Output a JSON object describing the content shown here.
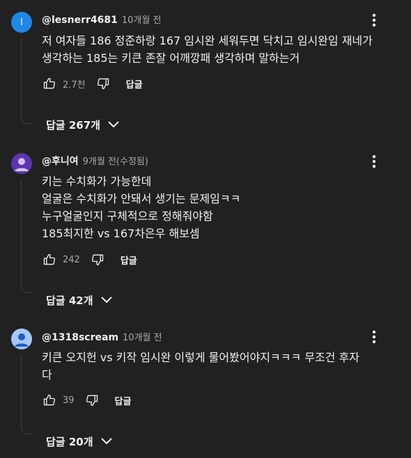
{
  "comments": [
    {
      "avatar_letter": "l",
      "author": "@lesnerr4681",
      "time": "10개월 전",
      "lines": [
        "저 여자들 186 정준하랑 167 임시완 세워두면 닥치고 임시완임 재네가",
        "생각하는 185는 키큰 존잘 어깨깡패 생각하며 말하는거"
      ],
      "likes": "2.7천",
      "reply_label": "답글",
      "replies_toggle": "답글 267개"
    },
    {
      "author": "@후니여",
      "time": "9개월 전(수정됨)",
      "lines": [
        "키는 수치화가 가능한데",
        "얼굴은 수치화가 안돼서 생기는 문제임ㅋㅋ",
        "누구얼굴인지 구체적으로 정해줘야함",
        "185최지한 vs 167차은우 해보셈"
      ],
      "likes": "242",
      "reply_label": "답글",
      "replies_toggle": "답글 42개"
    },
    {
      "author": "@1318scream",
      "time": "10개월 전",
      "lines": [
        "키큰 오지헌 vs 키작 임시완 이렇게 물어봤어야지ㅋㅋㅋ 무조건 후자",
        "다"
      ],
      "likes": "39",
      "reply_label": "답글",
      "replies_toggle": "답글 20개"
    }
  ],
  "icons": {
    "like": "thumb-up-icon",
    "dislike": "thumb-down-icon",
    "more": "more-vert-icon",
    "expand": "chevron-down-icon"
  },
  "colors": {
    "background": "#212121",
    "text": "#f1f1f1",
    "muted": "#aaaaaa",
    "avatar_blue": "#1e88e5",
    "avatar_purple": "#5e35b1",
    "avatar_light": "#a8c7fa"
  }
}
